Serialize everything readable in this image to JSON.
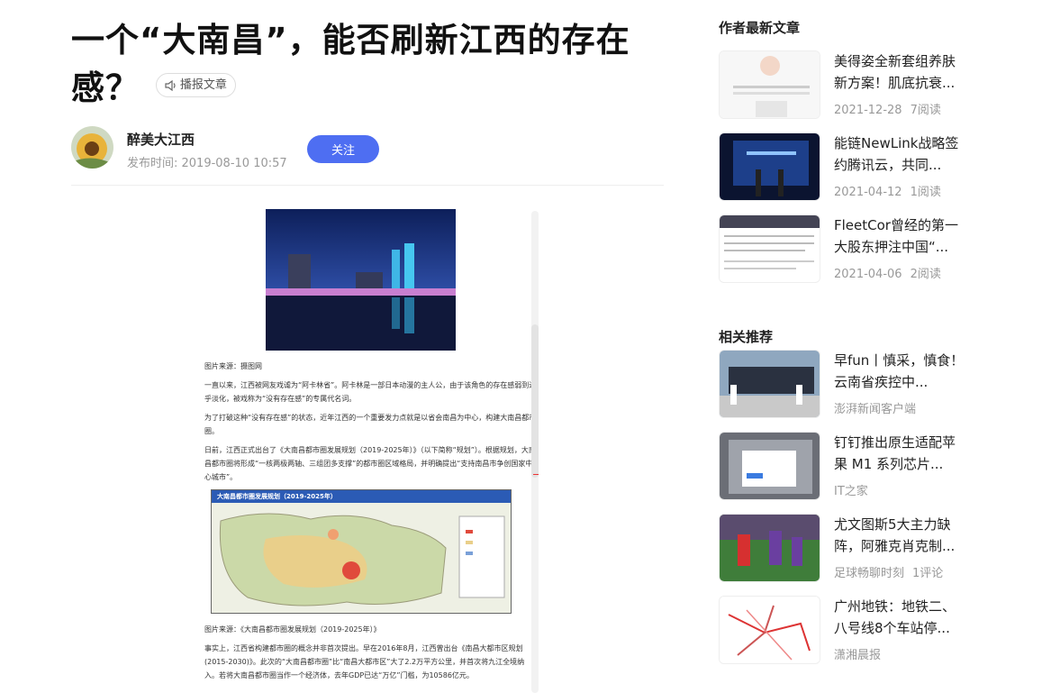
{
  "article": {
    "title": "一个“大南昌”，能否刷新江西的存在感？",
    "listen_label": "播报文章",
    "author": "醉美大江西",
    "publish_time": "发布时间: 2019-08-10 10:57",
    "follow_label": "关注",
    "captions": [
      "图片来源：摄图网",
      "图片来源：《大南昌都市圈发展规划（2019-2025年）》"
    ],
    "paragraphs": [
      "一直以来，江西被网友戏谑为“阿卡林省”。阿卡林是一部日本动漫的主人公，由于该角色的存在感弱到近乎淡化，被戏称为“没有存在感”的专属代名词。",
      "为了打破这种“没有存在感”的状态，近年江西的一个重要发力点就是以省会南昌为中心，构建大南昌都市圈。",
      "日前，江西正式出台了《大南昌都市圈发展规划（2019-2025年）》（以下简称“规划”）。根据规划，大南昌都市圈将形成“一核两极两轴、三组团多支撑”的都市圈区域格局，并明确提出“支持南昌市争创国家中心城市”。",
      "事实上，江西省构建都市圈的概念并非首次提出。早在2016年8月，江西曾出台《南昌大都市区规划(2015-2030)》。此次的“大南昌都市圈”比“南昌大都市区”大了2.2万平方公里，并首次将九江全境纳入。若将大南昌都市圈当作一个经济体，去年GDP已达“万亿”门槛，为10586亿元。"
    ],
    "map_title": "大南昌都市圈发展规划（2019-2025年）"
  },
  "sidebar": {
    "latest_heading": "作者最新文章",
    "latest": [
      {
        "title": "美得姿全新套组养肤新方案！肌底抗衰...",
        "date": "2021-12-28",
        "stat": "7阅读"
      },
      {
        "title": "能链NewLink战略签约腾讯云，共同...",
        "date": "2021-04-12",
        "stat": "1阅读"
      },
      {
        "title": "FleetCor曾经的第一大股东押注中国“...",
        "date": "2021-04-06",
        "stat": "2阅读"
      }
    ],
    "related_heading": "相关推荐",
    "related": [
      {
        "title": "早fun丨慎采，慎食！云南省疾控中...",
        "source": "澎湃新闻客户端",
        "stat": ""
      },
      {
        "title": "钉钉推出原生适配苹果 M1 系列芯片...",
        "source": "IT之家",
        "stat": ""
      },
      {
        "title": "尤文图斯5大主力缺阵，阿雅克肖克制...",
        "source": "足球畅聊时刻",
        "stat": "1评论"
      },
      {
        "title": "广州地铁：地铁二、八号线8个车站停...",
        "source": "潇湘晨报",
        "stat": ""
      }
    ]
  },
  "colors": {
    "accent": "#4e6ef2",
    "muted": "#999999"
  }
}
